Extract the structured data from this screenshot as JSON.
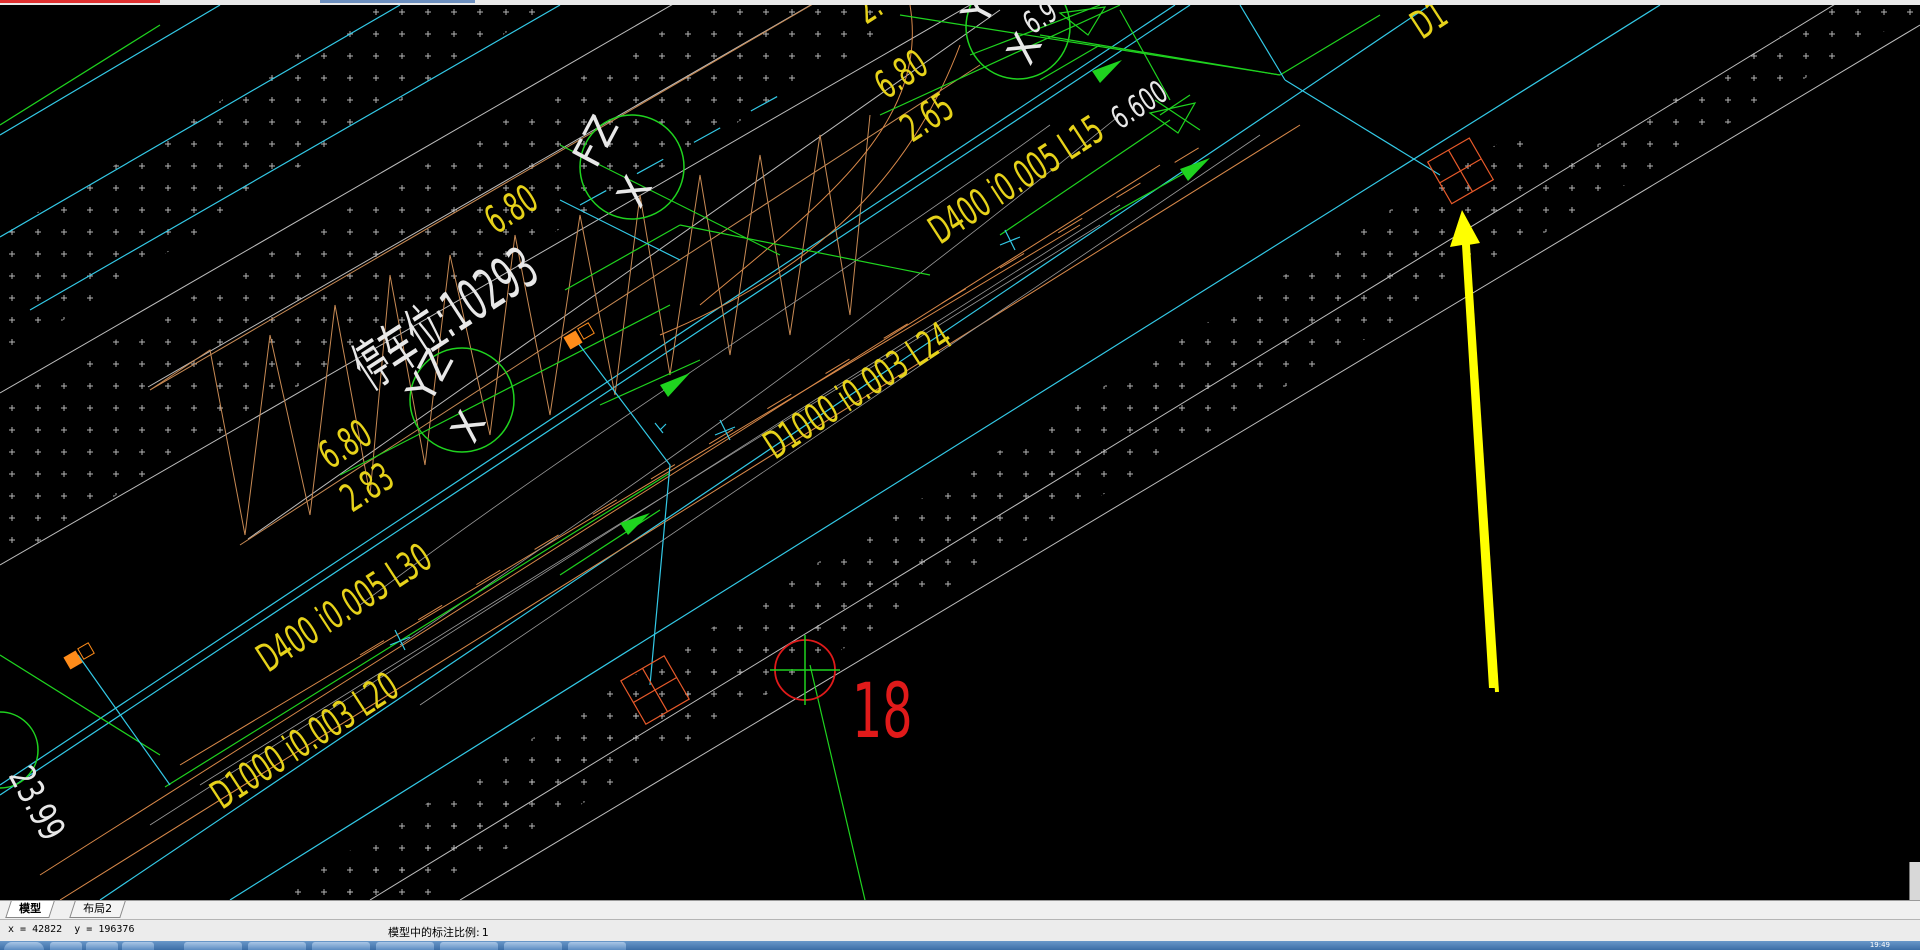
{
  "app": {
    "tabs": [
      {
        "label": "模型",
        "active": true
      },
      {
        "label": "布局2",
        "active": false
      }
    ],
    "status": {
      "x_label": "x = ",
      "x_value": "42822",
      "y_label": "y = ",
      "y_value": "196376",
      "scale_label": "模型中的标注比例:",
      "scale_value": "1"
    },
    "clock": "19:49"
  },
  "drawing": {
    "labels": {
      "parking": "停车位:10293",
      "fz_top": "FZ",
      "fz_bottom": "X",
      "yz_top": "YZ",
      "yz_bottom": "X",
      "yz2_top": "YZ",
      "yz2_bottom": "X",
      "elev_a1": "6.80",
      "elev_a2": "2.83",
      "elev_b1": "6.80",
      "elev_c1": "6.80",
      "elev_c2": "2.65",
      "elev_top": "2.",
      "elev_dim": "6.600",
      "elev_small": "6.9",
      "pipe_d400_a": "D400 i0.005 L30",
      "pipe_d400_b": "D400 i0.005 L15",
      "pipe_d1000_a": "D1000 i0.003 L20",
      "pipe_d1000_b": "D1000 i0.003 L24",
      "pipe_top_right": "D1",
      "elev_left": "23.99",
      "node_number": "18"
    },
    "colors": {
      "background": "#000000",
      "cyan": "#33c9e6",
      "green": "#1fd31f",
      "orange": "#d9894a",
      "yellow": "#e6d21a",
      "red": "#e01a1a",
      "white": "#e8e8e8",
      "grey": "#bdbdbd",
      "arrow": "#ffff00"
    }
  }
}
